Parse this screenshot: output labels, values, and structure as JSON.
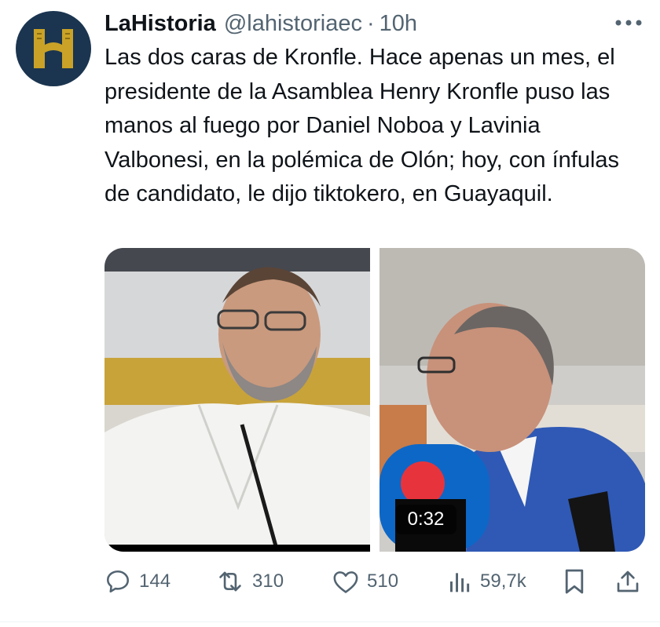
{
  "author": {
    "name": "LaHistoria",
    "handle": "@lahistoriaec",
    "separator": "·",
    "time": "10h",
    "avatar_icon": "lahistoria-h-logo",
    "avatar_color": "#1b3550",
    "avatar_letter_color": "#c9a227"
  },
  "tweet": {
    "text": "Las dos caras de Kronfle. Hace apenas un mes, el presidente de la Asamblea Henry Kronfle puso las manos al fuego por Daniel Noboa y Lavinia Valbonesi, en la polémica de Olón; hoy, con ínfulas de candidato, le dijo tiktokero, en Guayaquil."
  },
  "media": {
    "duration": "0:32"
  },
  "actions": {
    "replies": "144",
    "reposts": "310",
    "likes": "510",
    "views": "59,7k"
  },
  "colors": {
    "text": "#0f1419",
    "muted": "#536471"
  }
}
